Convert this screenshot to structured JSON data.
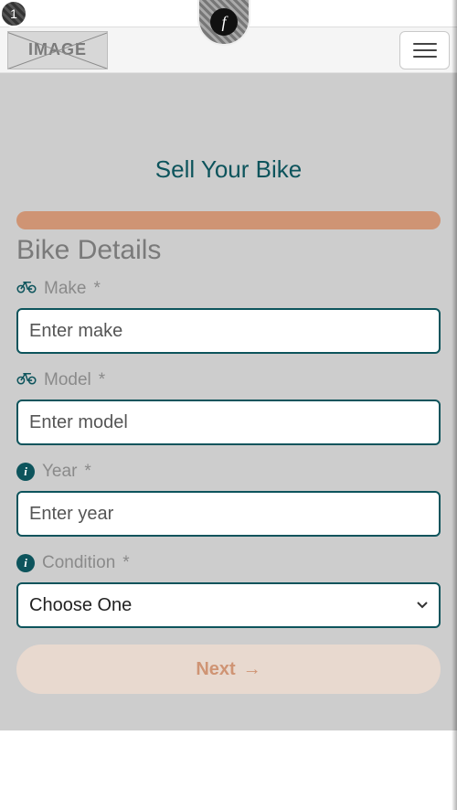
{
  "overlay": {
    "badge1": "1",
    "badgef": "f"
  },
  "header": {
    "logo_text": "IMAGE"
  },
  "page": {
    "title": "Sell Your Bike",
    "section_heading": "Bike Details"
  },
  "form": {
    "make": {
      "label": "Make",
      "required": "*",
      "placeholder": "Enter make",
      "icon": "bike"
    },
    "model": {
      "label": "Model",
      "required": "*",
      "placeholder": "Enter model",
      "icon": "bike"
    },
    "year": {
      "label": "Year",
      "required": "*",
      "placeholder": "Enter year",
      "icon": "info"
    },
    "condition": {
      "label": "Condition",
      "required": "*",
      "selected": "Choose One",
      "icon": "info"
    }
  },
  "actions": {
    "next_label": "Next"
  },
  "colors": {
    "teal": "#0d545c",
    "accent": "#cf9474"
  }
}
